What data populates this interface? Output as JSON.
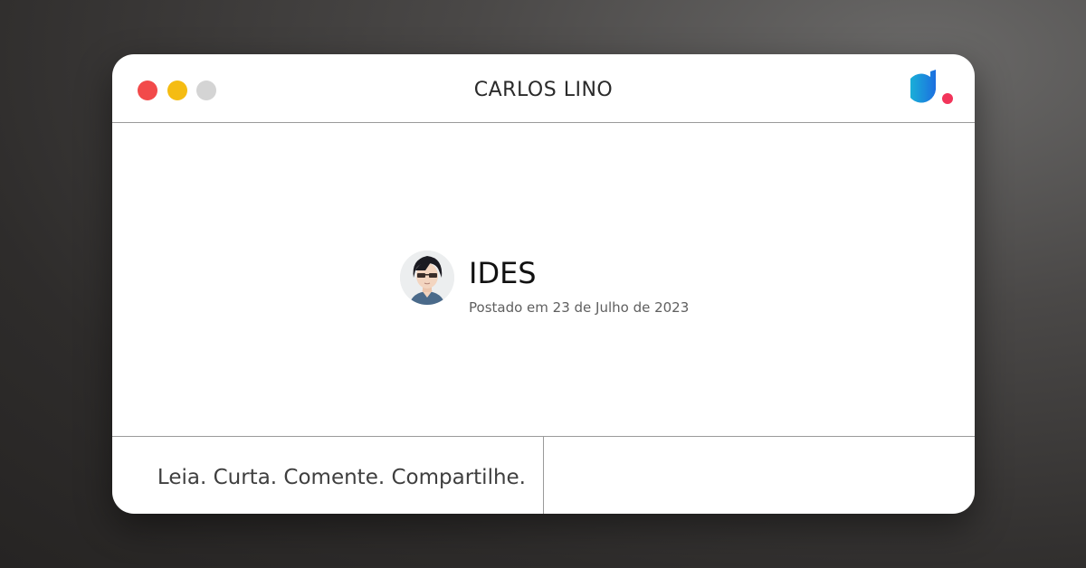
{
  "window": {
    "title": "CARLOS LINO",
    "controls": [
      {
        "name": "close",
        "color": "#f24a4a"
      },
      {
        "name": "minimize",
        "color": "#f5bc12"
      },
      {
        "name": "maximize",
        "color": "#d4d4d4"
      }
    ],
    "logo": {
      "icon": "dio-logo-icon",
      "gradient": [
        "#1c6fe0",
        "#19b8d6"
      ],
      "dot_color": "#f2345a"
    }
  },
  "post": {
    "title": "IDES",
    "date": "Postado em 23 de Julho de 2023",
    "avatar_icon": "user-avatar-icon"
  },
  "footer": {
    "tagline": "Leia. Curta. Comente. Compartilhe."
  }
}
